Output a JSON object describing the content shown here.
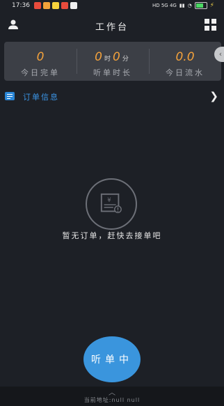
{
  "status_bar": {
    "time": "17:36",
    "network": "HD 5G 4G",
    "notif_colors": [
      "#e94b3c",
      "#f2a33a",
      "#f7d33c",
      "#e94b3c",
      "#f0f0f0"
    ]
  },
  "header": {
    "title": "工作台",
    "left_icon": "person-icon",
    "right_icon": "grid-icon"
  },
  "stats": [
    {
      "value": "0",
      "label": "今日完单"
    },
    {
      "value_hours": "0",
      "hour_unit": "时",
      "value_minutes": "0",
      "minute_unit": "分",
      "label": "听单时长"
    },
    {
      "value": "0.0",
      "label": "今日流水"
    }
  ],
  "order_section": {
    "label": "订单信息",
    "icon": "list-icon"
  },
  "empty_state": {
    "icon": "empty-orders-icon",
    "text": "暂无订单，赶快去接单吧"
  },
  "primary_action": {
    "label": "听单中"
  },
  "footer": {
    "location_text": "当前地址:null null"
  },
  "colors": {
    "accent": "#3a95dd",
    "value_orange": "#f4a23b",
    "background": "#1d2026"
  }
}
